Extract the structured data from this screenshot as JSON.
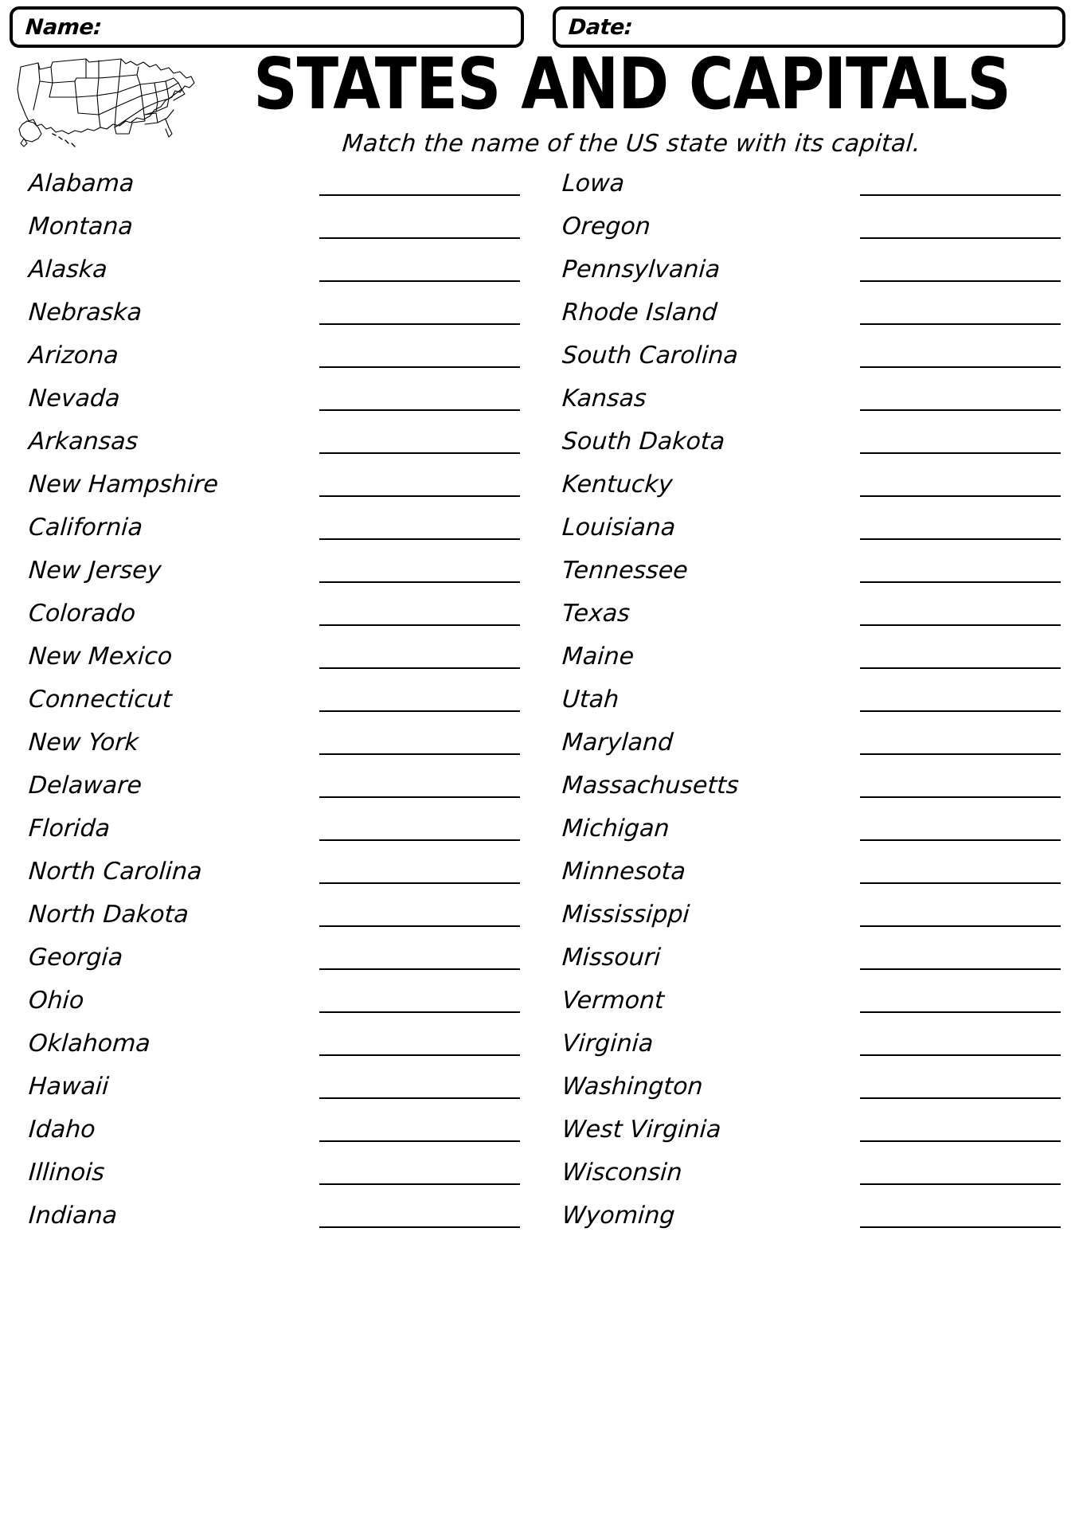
{
  "header": {
    "name_label": "Name:",
    "date_label": "Date:"
  },
  "title": "STATES AND CAPITALS",
  "subtitle": "Match the name of the US state with its capital.",
  "map": {
    "icon": "us-map-outline"
  },
  "columns": {
    "left": [
      "Alabama",
      "Montana",
      "Alaska",
      "Nebraska",
      "Arizona",
      "Nevada",
      "Arkansas",
      "New Hampshire",
      "California",
      "New Jersey",
      "Colorado",
      "New Mexico",
      "Connecticut",
      "New York",
      "Delaware",
      "Florida",
      "North Carolina",
      "North Dakota",
      "Georgia",
      "Ohio",
      "Oklahoma",
      "Hawaii",
      "Idaho",
      "Illinois",
      "Indiana"
    ],
    "right": [
      "Lowa",
      "Oregon",
      "Pennsylvania",
      "Rhode Island",
      "South Carolina",
      "Kansas",
      "South Dakota",
      "Kentucky",
      "Louisiana",
      "Tennessee",
      "Texas",
      "Maine",
      "Utah",
      "Maryland",
      "Massachusetts",
      "Michigan",
      "Minnesota",
      "Mississippi",
      "Missouri",
      "Vermont",
      "Virginia",
      "Washington",
      "West Virginia",
      "Wisconsin",
      "Wyoming"
    ]
  },
  "colors": {
    "ink": "#000000",
    "paper": "#ffffff"
  }
}
